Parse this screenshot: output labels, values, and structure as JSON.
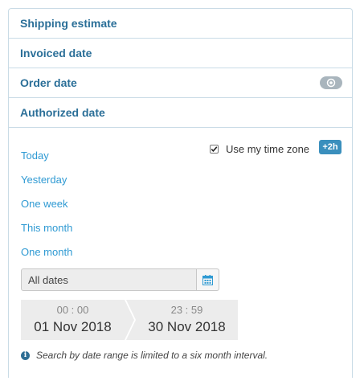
{
  "accordion": {
    "items": [
      {
        "label": "Shipping estimate"
      },
      {
        "label": "Invoiced date"
      },
      {
        "label": "Order date",
        "icon": "eye-icon"
      },
      {
        "label": "Authorized date"
      }
    ]
  },
  "presets": [
    "Today",
    "Yesterday",
    "One week",
    "This month",
    "One month"
  ],
  "timezone": {
    "label": "Use my time zone",
    "checked": true,
    "offset_badge": "+2h"
  },
  "date_select": {
    "value": "All dates",
    "icon": "calendar-icon"
  },
  "range": {
    "start": {
      "time": "00 : 00",
      "date": "01 Nov 2018"
    },
    "end": {
      "time": "23 : 59",
      "date": "30 Nov 2018"
    }
  },
  "info": {
    "icon": "info-icon",
    "text": "Search by date range is limited to a six month interval."
  },
  "colors": {
    "accent": "#2f9ad3",
    "heading": "#2b6f98",
    "border": "#c9dbe6",
    "badge": "#3a8fbd"
  }
}
